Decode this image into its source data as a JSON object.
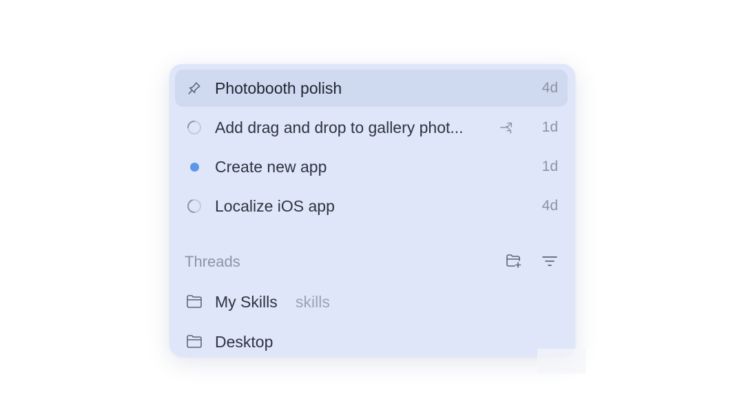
{
  "recent": {
    "items": [
      {
        "icon": "pin-icon",
        "title": "Photobooth polish",
        "time": "4d",
        "active": true
      },
      {
        "icon": "spinner-icon",
        "title": "Add drag and drop to gallery phot...",
        "time": "1d",
        "action_icon": "share-arrow-icon"
      },
      {
        "icon": "unread-dot-icon",
        "title": "Create new app",
        "time": "1d",
        "dot_color": "#5b97e8"
      },
      {
        "icon": "spinner-icon",
        "title": "Localize iOS app",
        "time": "4d"
      }
    ]
  },
  "threads": {
    "title": "Threads",
    "new_folder_icon": "new-folder-icon",
    "filter_icon": "filter-icon",
    "items": [
      {
        "icon": "folder-icon",
        "label": "My Skills",
        "sublabel": "skills"
      },
      {
        "icon": "folder-icon",
        "label": "Desktop"
      }
    ]
  },
  "colors": {
    "panel_bg": "#dfe6f9",
    "active_row_bg": "#cfd9f0",
    "accent_dot": "#5b97e8",
    "text_primary": "#2e3340",
    "text_muted": "#8b92a3"
  }
}
